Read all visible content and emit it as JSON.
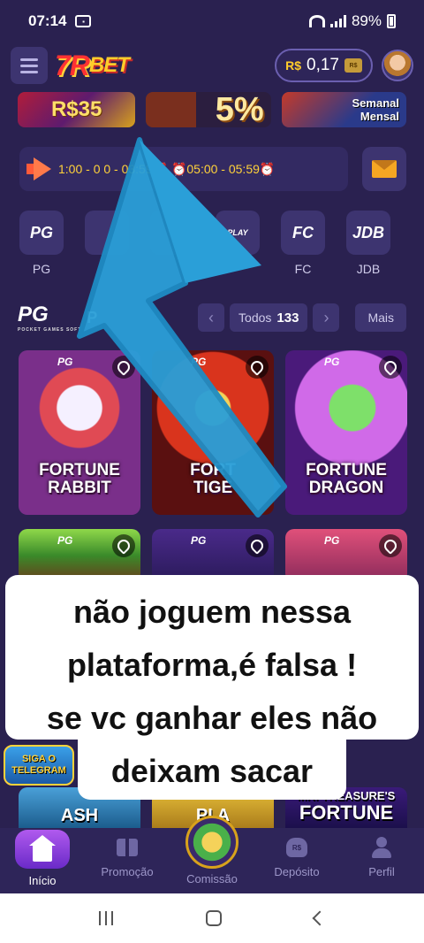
{
  "status_bar": {
    "time": "07:14",
    "battery": "89%"
  },
  "header": {
    "logo_main": "7R",
    "logo_sub": "BET",
    "balance_currency": "R$",
    "balance_amount": "0,17",
    "wallet_icon_text": "R$"
  },
  "banners": [
    {
      "text": "R$35"
    },
    {
      "text": "5%"
    },
    {
      "line1": "Semanal",
      "line2": "Mensal"
    }
  ],
  "marquee": {
    "text": "1:00 - 0 0 - 03:59⏰ ⏰05:00 - 05:59⏰"
  },
  "providers": [
    {
      "icon": "PG",
      "label": "PG"
    },
    {
      "icon": "",
      "label": ""
    },
    {
      "icon": "",
      "label": ""
    },
    {
      "icon": "PLAY",
      "label": ""
    },
    {
      "icon": "FC",
      "label": "FC"
    },
    {
      "icon": "JDB",
      "label": "JDB"
    }
  ],
  "section": {
    "logo": "PG",
    "logo_sub": "POCKET GAMES SOFT",
    "title": "P",
    "count_label": "Todos",
    "count_value": "133",
    "more_label": "Mais",
    "prev_glyph": "‹",
    "next_glyph": "›"
  },
  "games": [
    {
      "name_line1": "FORTUNE",
      "name_line2": "RABBIT",
      "tag": "PG"
    },
    {
      "name_line1": "FORT",
      "name_line2": "TIGE",
      "tag": "PG"
    },
    {
      "name_line1": "FORTUNE",
      "name_line2": "DRAGON",
      "tag": "PG"
    },
    {
      "tag": "PG"
    },
    {
      "tag": "PG"
    },
    {
      "tag": "PG"
    }
  ],
  "overlay": {
    "line1": "não joguem nessa",
    "line2": "plataforma,é falsa !",
    "line3": "se vc ganhar eles não",
    "line4": "deixam sacar"
  },
  "telegram": {
    "line1": "SIGA O",
    "line2": "TELEGRAM"
  },
  "bottom_games": [
    {
      "text": "ASH"
    },
    {
      "text": "PI A"
    },
    {
      "line1": "MR. TREASURE'S",
      "line2": "FORTUNE"
    }
  ],
  "bottom_nav": [
    {
      "label": "Início"
    },
    {
      "label": "Promoção"
    },
    {
      "label": "Comissão"
    },
    {
      "label": "Depósito",
      "icon_text": "R$"
    },
    {
      "label": "Perfil"
    }
  ],
  "colors": {
    "background": "#2a2150",
    "accent_purple": "#b05aee",
    "gold": "#ffd23a",
    "annotation_arrow": "#2a9fd8"
  }
}
